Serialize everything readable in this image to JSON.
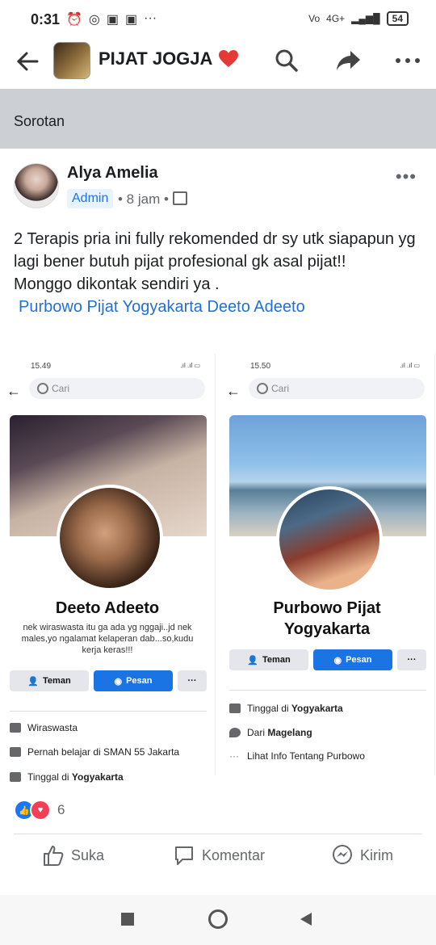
{
  "status": {
    "time": "0:31",
    "battery": "54",
    "net": "4G+"
  },
  "appbar": {
    "group_title": "PIJAT JOGJA",
    "icons": [
      "back-arrow-icon",
      "search-icon",
      "share-icon",
      "more-icon"
    ]
  },
  "section": {
    "label": "Sorotan"
  },
  "post": {
    "author": "Alya Amelia",
    "badge": "Admin",
    "time": "• 8 jam •",
    "text_lines": [
      "2 Terapis pria ini fully rekomended dr sy utk siapapun yg lagi bener butuh pijat profesional gk asal pijat!!",
      "Monggo dikontak sendiri ya ."
    ],
    "tags": "Purbowo Pijat Yogyakarta Deeto Adeeto",
    "reaction_count": "6"
  },
  "shot_left": {
    "time": "15.49",
    "search_placeholder": "Cari",
    "name": "Deeto Adeeto",
    "bio": "nek wiraswasta itu ga ada yg nggaji..jd nek males,yo ngalamat kelaperan dab...so,kudu kerja  keras!!!",
    "btn_friend": "Teman",
    "btn_message": "Pesan",
    "btn_more": "···",
    "info": [
      {
        "text": "Wiraswasta",
        "bold": ""
      },
      {
        "text": "Pernah belajar di SMAN 55 Jakarta",
        "bold": ""
      },
      {
        "text": "Tinggal di ",
        "bold": "Yogyakarta"
      }
    ]
  },
  "shot_right": {
    "time": "15.50",
    "search_placeholder": "Cari",
    "name_line1": "Purbowo Pijat",
    "name_line2": "Yogyakarta",
    "btn_friend": "Teman",
    "btn_message": "Pesan",
    "btn_more": "···",
    "info": [
      {
        "text": "Tinggal di ",
        "bold": "Yogyakarta"
      },
      {
        "text": "Dari ",
        "bold": "Magelang"
      },
      {
        "text": "Lihat Info Tentang Purbowo",
        "bold": ""
      }
    ]
  },
  "actions": {
    "like": "Suka",
    "comment": "Komentar",
    "send": "Kirim"
  },
  "colors": {
    "link": "#216fdb",
    "fb_blue": "#1b74e4",
    "heart": "#e53935"
  }
}
